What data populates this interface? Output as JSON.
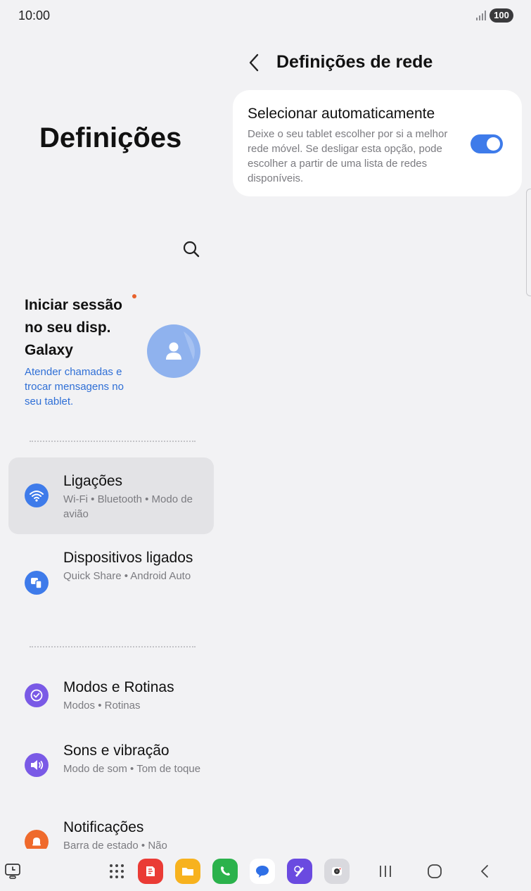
{
  "status_bar": {
    "time": "10:00",
    "battery": "100"
  },
  "left_pane": {
    "title": "Definições",
    "account": {
      "title": "Iniciar sessão no seu disp. Galaxy",
      "subtitle": "Atender chamadas e trocar mensagens no seu tablet."
    },
    "menu": [
      {
        "title": "Ligações",
        "subtitle": "Wi-Fi • Bluetooth • Modo de avião",
        "icon": "wifi-icon",
        "color": "#3e7bea"
      },
      {
        "title": "Dispositivos ligados",
        "subtitle": "Quick Share • Android Auto",
        "icon": "connected-devices-icon",
        "color": "#3e7bea"
      },
      {
        "title": "Modos e Rotinas",
        "subtitle": "Modos • Rotinas",
        "icon": "modes-routines-icon",
        "color": "#7a5ae6"
      },
      {
        "title": "Sons e vibração",
        "subtitle": "Modo de som • Tom de toque",
        "icon": "sound-icon",
        "color": "#7a5ae6"
      },
      {
        "title": "Notificações",
        "subtitle": "Barra de estado • Não",
        "icon": "bell-icon",
        "color": "#ef6a2c"
      }
    ]
  },
  "right_pane": {
    "title": "Definições de rede",
    "option": {
      "title": "Selecionar automaticamente",
      "description": "Deixe o seu tablet escolher por si a melhor rede móvel. Se desligar esta opção, pode escolher a partir de uma lista de redes disponíveis.",
      "enabled": true
    }
  },
  "dock": {
    "apps": [
      "apps-grid-icon",
      "samsung-notes-icon",
      "my-files-icon",
      "phone-icon",
      "messages-icon",
      "ai-assistant-icon",
      "camera-icon"
    ],
    "nav": [
      "recents-button",
      "home-button",
      "back-nav-button"
    ]
  }
}
